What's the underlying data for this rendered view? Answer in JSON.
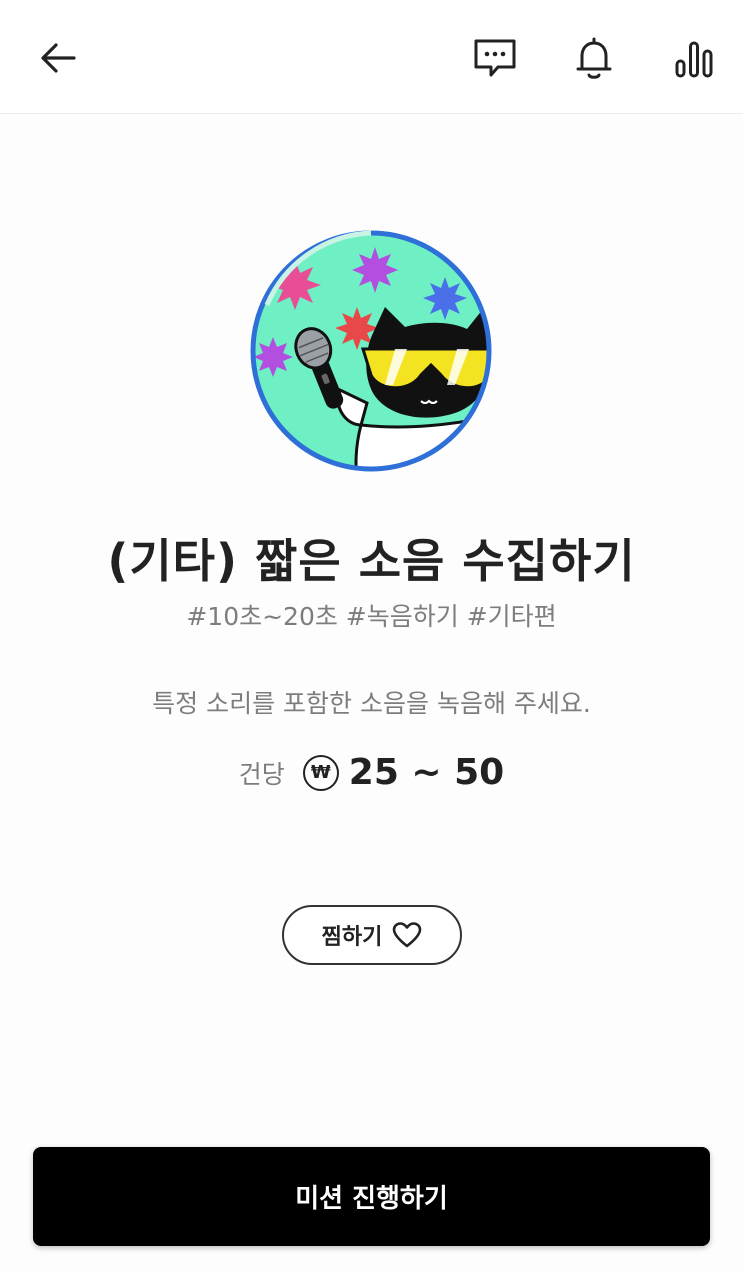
{
  "header": {
    "back_icon": "arrow-left-icon",
    "chat_icon": "chat-bubble-icon",
    "bell_icon": "bell-icon",
    "stats_icon": "bar-chart-icon"
  },
  "mission": {
    "title": "(기타) 짧은 소음 수집하기",
    "tags": "#10초~20초 #녹음하기 #기타편",
    "description": "특정 소리를 포함한 소음을 녹음해 주세요.",
    "price_label": "건당",
    "currency_symbol": "₩",
    "price_range": "25 ~ 50"
  },
  "actions": {
    "favorite_label": "찜하기",
    "favorite_icon": "heart-outline-icon",
    "start_label": "미션 진행하기"
  },
  "colors": {
    "accent_ring": "#2e6fd8",
    "avatar_bg": "#6ef0c4",
    "button_bg": "#000000"
  }
}
